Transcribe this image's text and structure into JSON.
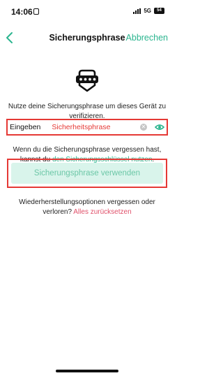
{
  "status_bar": {
    "time": "14:06",
    "network": "5G",
    "battery": "54"
  },
  "header": {
    "title": "Sicherungsphrase",
    "cancel_label": "Abbrechen"
  },
  "icons": {
    "back": "chevron-left-icon",
    "shield": "shield-password-icon",
    "clear": "clear-icon",
    "visibility": "eye-icon"
  },
  "intro": {
    "text": "Nutze deine Sicherungsphrase um dieses Gerät zu verifizieren."
  },
  "input": {
    "label": "Eingeben",
    "value": "Sicherheitsphrase"
  },
  "forgot": {
    "prefix": "Wenn du die Sicherungsphrase vergessen hast, kannst du ",
    "link": "den Sicherungsschlüssel nutzen",
    "suffix": "."
  },
  "primary": {
    "label": "Sicherungsphrase verwenden"
  },
  "recovery": {
    "prefix": "Wiederherstellungsoptionen vergessen oder verloren? ",
    "link": "Alles zurücksetzen"
  },
  "colors": {
    "accent": "#2bb58f",
    "highlight": "#e53935",
    "reset_link": "#e0506a",
    "button_bg": "#d9f4eb"
  }
}
